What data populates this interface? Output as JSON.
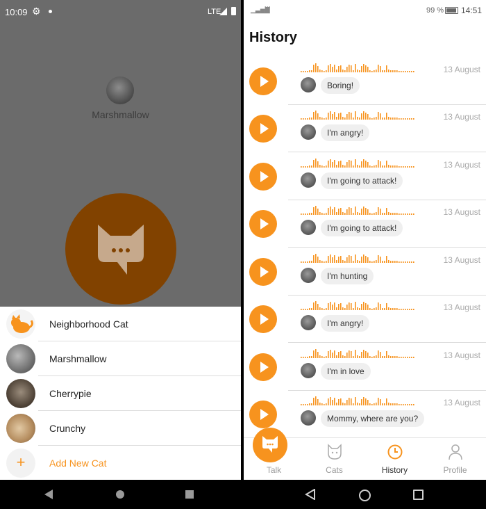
{
  "left": {
    "status": {
      "time": "10:09",
      "network": "LTE"
    },
    "selected_cat": {
      "name": "Marshmallow"
    },
    "cats": [
      {
        "name": "Neighborhood Cat",
        "avatar": "cartoon-cat-icon"
      },
      {
        "name": "Marshmallow",
        "avatar": "cat-photo"
      },
      {
        "name": "Cherrypie",
        "avatar": "cat-photo"
      },
      {
        "name": "Crunchy",
        "avatar": "cat-photo"
      }
    ],
    "add_cat_label": "Add New Cat",
    "add_icon": "+"
  },
  "right": {
    "status": {
      "battery": "99 %",
      "time": "14:51"
    },
    "title": "History",
    "items": [
      {
        "date": "13 August",
        "text": "Boring!"
      },
      {
        "date": "13 August",
        "text": "I'm angry!"
      },
      {
        "date": "13 August",
        "text": "I'm going to attack!"
      },
      {
        "date": "13 August",
        "text": "I'm going to attack!"
      },
      {
        "date": "13 August",
        "text": "I'm hunting"
      },
      {
        "date": "13 August",
        "text": "I'm angry!"
      },
      {
        "date": "13 August",
        "text": "I'm in love"
      },
      {
        "date": "13 August",
        "text": "Mommy, where are you?"
      }
    ],
    "tabs": [
      {
        "label": "Talk",
        "icon": "cat-chat-icon"
      },
      {
        "label": "Cats",
        "icon": "cat-face-icon"
      },
      {
        "label": "History",
        "icon": "clock-icon",
        "active": true
      },
      {
        "label": "Profile",
        "icon": "person-icon"
      }
    ]
  },
  "colors": {
    "accent": "#f7931e",
    "overlay": "#6b6b6b",
    "active_button_dim": "#814200"
  }
}
